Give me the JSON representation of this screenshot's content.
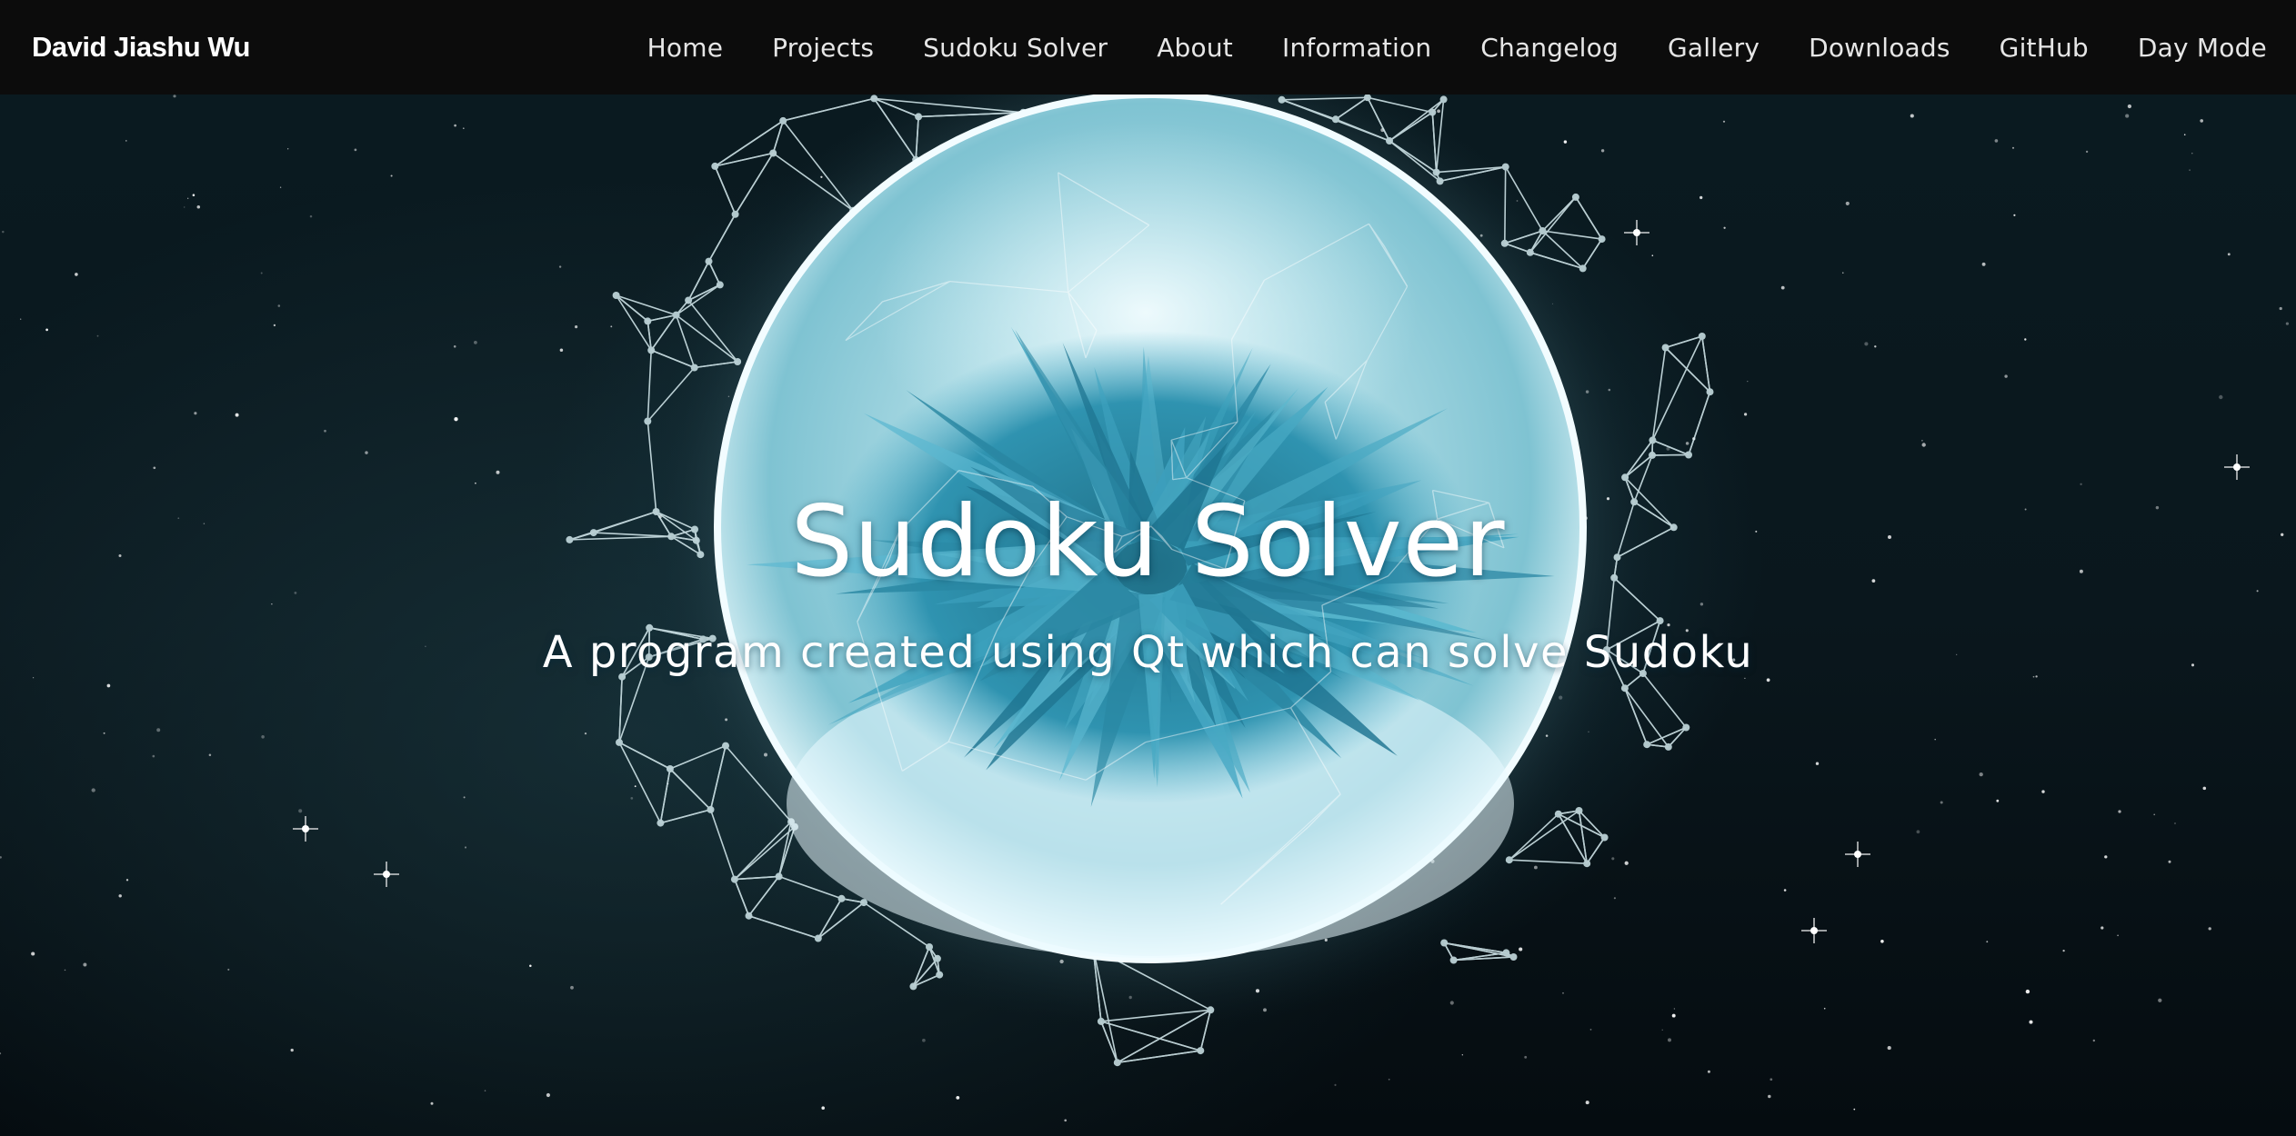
{
  "navbar": {
    "brand": "David Jiashu Wu",
    "items": [
      {
        "label": "Home"
      },
      {
        "label": "Projects"
      },
      {
        "label": "Sudoku Solver"
      },
      {
        "label": "About"
      },
      {
        "label": "Information"
      },
      {
        "label": "Changelog"
      },
      {
        "label": "Gallery"
      },
      {
        "label": "Downloads"
      },
      {
        "label": "GitHub"
      },
      {
        "label": "Day Mode"
      }
    ]
  },
  "hero": {
    "title": "Sudoku Solver",
    "subtitle": "A program created using Qt which can solve Sudoku",
    "background_image": "glowing-sphere-network-in-space"
  },
  "colors": {
    "navbar_bg": "#0c0c0c",
    "nav_text": "#e6e6e6",
    "hero_text": "#ffffff",
    "sphere_accent": "#3a9bb5"
  }
}
